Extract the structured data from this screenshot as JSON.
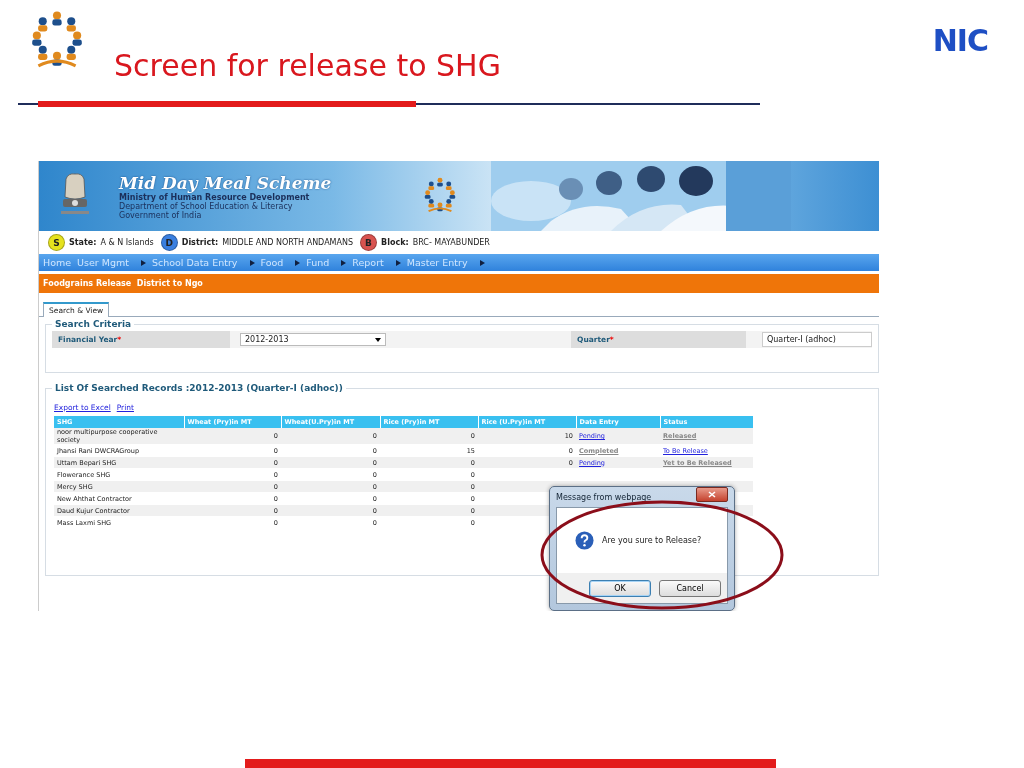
{
  "slide": {
    "title": "Screen for release to SHG",
    "brand": "NIC"
  },
  "app": {
    "banner": {
      "title": "Mid Day Meal Scheme",
      "lines": [
        "Ministry of Human Resource Development",
        "Department of School Education & Literacy",
        "Government of India"
      ]
    },
    "location": [
      {
        "badge": "S",
        "label": "State:",
        "value": "A & N Islands",
        "color": "#e6e21e"
      },
      {
        "badge": "D",
        "label": "District:",
        "value": "MIDDLE AND NORTH ANDAMANS",
        "color": "#3a7fe0"
      },
      {
        "badge": "B",
        "label": "Block:",
        "value": "BRC- MAYABUNDER",
        "color": "#d9534f"
      }
    ],
    "menu": [
      {
        "label": "Home",
        "submenu": false
      },
      {
        "label": "User Mgmt",
        "submenu": true
      },
      {
        "label": "School Data Entry",
        "submenu": true
      },
      {
        "label": "Food",
        "submenu": true
      },
      {
        "label": "Fund",
        "submenu": true
      },
      {
        "label": "Report",
        "submenu": true
      },
      {
        "label": "Master Entry",
        "submenu": true
      }
    ],
    "page_title": "Foodgrains Release  District to Ngo",
    "tabs": [
      {
        "label": "Search & View",
        "selected": true
      }
    ],
    "search": {
      "legend": "Search Criteria",
      "fields": [
        {
          "label": "Financial Year",
          "required_mark": "*",
          "value": "2012-2013",
          "kind": "dropdown"
        },
        {
          "label": "Quarter",
          "required_mark": "*",
          "value": "Quarter-I (adhoc)",
          "kind": "box"
        }
      ]
    },
    "records": {
      "legend": "List Of Searched Records :2012-2013 (Quarter-I (adhoc))",
      "actions": [
        "Export to Excel",
        "Print"
      ],
      "columns": [
        "SHG",
        "Wheat (Pry)in MT",
        "Wheat(U.Pry)in MT",
        "Rice (Pry)in MT",
        "Rice (U.Pry)in MT",
        "Data Entry",
        "Status"
      ],
      "rows": [
        {
          "cells": [
            "noor multipurpose cooperative society",
            "0",
            "0",
            "0",
            "10"
          ],
          "data_entry": {
            "text": "Pending",
            "link": true
          },
          "status": {
            "text": "Released",
            "link": false
          }
        },
        {
          "cells": [
            "Jhansi Rani DWCRAGroup",
            "0",
            "0",
            "15",
            "0"
          ],
          "data_entry": {
            "text": "Completed",
            "link": false
          },
          "status": {
            "text": "To Be Release",
            "link": true
          }
        },
        {
          "cells": [
            "Uttam Bepari SHG",
            "0",
            "0",
            "0",
            "0"
          ],
          "data_entry": {
            "text": "Pending",
            "link": true
          },
          "status": {
            "text": "Yet to Be Released",
            "link": false
          }
        },
        {
          "cells": [
            "Flowerance SHG",
            "0",
            "0",
            "0"
          ]
        },
        {
          "cells": [
            "Mercy SHG",
            "0",
            "0",
            "0"
          ]
        },
        {
          "cells": [
            "New Ahthat Contractor",
            "0",
            "0",
            "0"
          ]
        },
        {
          "cells": [
            "Daud Kujur Contractor",
            "0",
            "0",
            "0"
          ]
        },
        {
          "cells": [
            "Mass Laxmi SHG",
            "0",
            "0",
            "0"
          ]
        }
      ]
    }
  },
  "dialog": {
    "title": "Message from webpage",
    "message": "Are you sure to Release?",
    "buttons": [
      {
        "label": "OK",
        "selected": true
      },
      {
        "label": "Cancel",
        "selected": false
      }
    ]
  }
}
